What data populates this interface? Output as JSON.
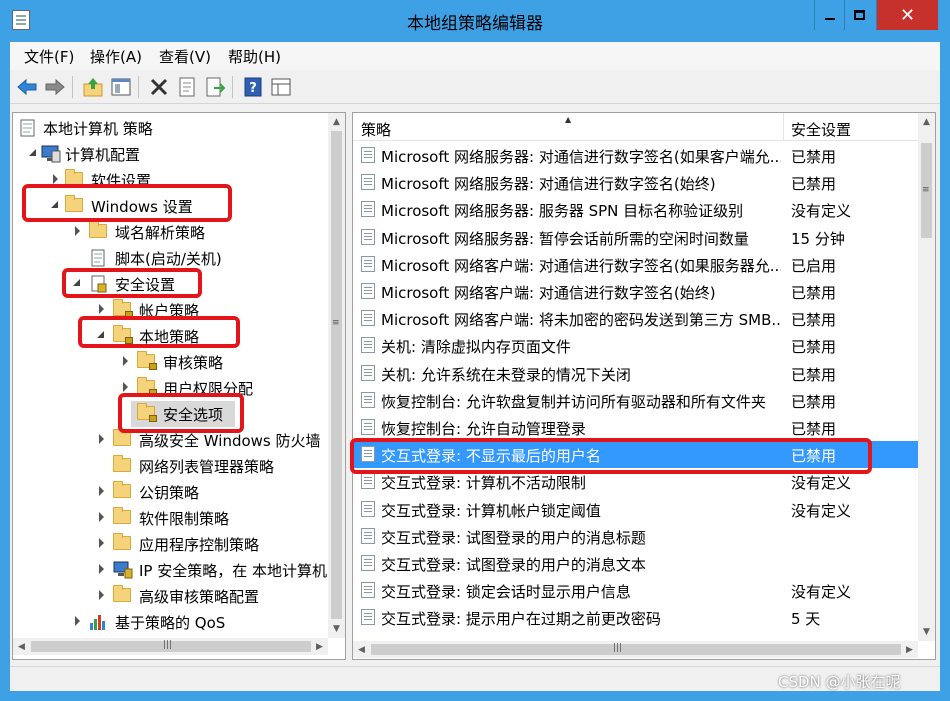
{
  "window": {
    "title": "本地组策略编辑器",
    "close_glyph": "✕"
  },
  "menu": [
    "文件(F)",
    "操作(A)",
    "查看(V)",
    "帮助(H)"
  ],
  "toolbar": [
    "back-icon",
    "forward-icon",
    "up-folder-icon",
    "show-hide-tree-icon",
    "delete-icon",
    "properties-icon",
    "export-icon",
    "help-icon",
    "view-icon"
  ],
  "tree": {
    "root": "本地计算机 策略",
    "computer_config": "计算机配置",
    "software_settings": "软件设置",
    "windows_settings": "Windows 设置",
    "name_resolution": "域名解析策略",
    "scripts": "脚本(启动/关机)",
    "security_settings": "安全设置",
    "account_policies": "帐户策略",
    "local_policies": "本地策略",
    "audit_policy": "审核策略",
    "user_rights": "用户权限分配",
    "security_options": "安全选项",
    "firewall": "高级安全 Windows 防火墙",
    "network_list": "网络列表管理器策略",
    "public_key": "公钥策略",
    "software_restriction": "软件限制策略",
    "app_control": "应用程序控制策略",
    "ip_security": "IP 安全策略，在 本地计算机",
    "advanced_audit": "高级审核策略配置",
    "qos": "基于策略的 QoS"
  },
  "list": {
    "col_policy": "策略",
    "col_setting": "安全设置",
    "rows": [
      {
        "policy": "Microsoft 网络服务器: 对通信进行数字签名(如果客户端允...",
        "setting": "已禁用"
      },
      {
        "policy": "Microsoft 网络服务器: 对通信进行数字签名(始终)",
        "setting": "已禁用"
      },
      {
        "policy": "Microsoft 网络服务器: 服务器 SPN 目标名称验证级别",
        "setting": "没有定义"
      },
      {
        "policy": "Microsoft 网络服务器: 暂停会话前所需的空闲时间数量",
        "setting": "15 分钟"
      },
      {
        "policy": "Microsoft 网络客户端: 对通信进行数字签名(如果服务器允...",
        "setting": "已启用"
      },
      {
        "policy": "Microsoft 网络客户端: 对通信进行数字签名(始终)",
        "setting": "已禁用"
      },
      {
        "policy": "Microsoft 网络客户端: 将未加密的密码发送到第三方 SMB...",
        "setting": "已禁用"
      },
      {
        "policy": "关机: 清除虚拟内存页面文件",
        "setting": "已禁用"
      },
      {
        "policy": "关机: 允许系统在未登录的情况下关闭",
        "setting": "已禁用"
      },
      {
        "policy": "恢复控制台: 允许软盘复制并访问所有驱动器和所有文件夹",
        "setting": "已禁用"
      },
      {
        "policy": "恢复控制台: 允许自动管理登录",
        "setting": "已禁用"
      },
      {
        "policy": "交互式登录: 不显示最后的用户名",
        "setting": "已禁用"
      },
      {
        "policy": "交互式登录: 计算机不活动限制",
        "setting": "没有定义"
      },
      {
        "policy": "交互式登录: 计算机帐户锁定阈值",
        "setting": "没有定义"
      },
      {
        "policy": "交互式登录: 试图登录的用户的消息标题",
        "setting": ""
      },
      {
        "policy": "交互式登录: 试图登录的用户的消息文本",
        "setting": ""
      },
      {
        "policy": "交互式登录: 锁定会话时显示用户信息",
        "setting": "没有定义"
      },
      {
        "policy": "交互式登录: 提示用户在过期之前更改密码",
        "setting": "5 天"
      }
    ]
  },
  "watermark": "CSDN @小张在呢",
  "colors": {
    "title_bar": "#3ea1e6",
    "selection": "#3399ff",
    "highlight_box": "#e3151b",
    "close_button": "#c7312b"
  }
}
